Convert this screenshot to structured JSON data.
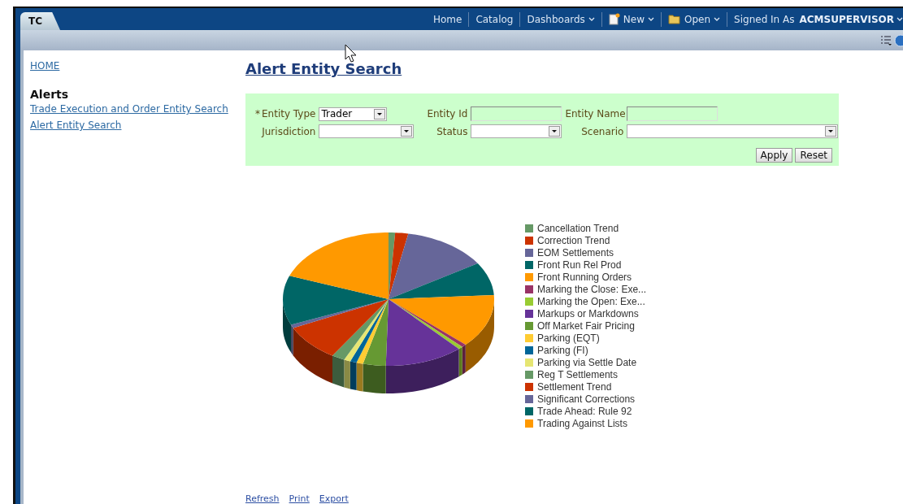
{
  "tab": {
    "label": "TC",
    "selected": true
  },
  "nav": [
    {
      "label": "Home",
      "kind": "plain"
    },
    {
      "label": "Catalog",
      "kind": "plain"
    },
    {
      "label": "Dashboards",
      "kind": "dropdown"
    },
    {
      "label": "New",
      "kind": "create"
    },
    {
      "label": "Open",
      "kind": "folder"
    }
  ],
  "signed_in": {
    "label": "Signed In As",
    "user": "ACMSUPERVISOR"
  },
  "sidebar": {
    "home": "HOME",
    "heading": "Alerts",
    "links": [
      "Trade Execution and Order Entity Search",
      "Alert Entity Search"
    ]
  },
  "page_title": "Alert Entity Search",
  "form": {
    "rows": [
      [
        {
          "label": "Entity Type",
          "required": true,
          "kind": "select",
          "value": "Trader"
        },
        {
          "label": "Entity Id",
          "required": false,
          "kind": "text"
        },
        {
          "label": "Entity Name",
          "required": false,
          "kind": "text"
        }
      ],
      [
        {
          "label": "Jurisdiction",
          "required": false,
          "kind": "select"
        },
        {
          "label": "Status",
          "required": false,
          "kind": "select"
        },
        {
          "label": "Scenario",
          "required": false,
          "kind": "select"
        }
      ]
    ],
    "required_mark": "*",
    "buttons": [
      "Apply",
      "Reset"
    ]
  },
  "legend": [
    {
      "label": "Cancellation Trend",
      "color": "#669966"
    },
    {
      "label": "Correction Trend",
      "color": "#cc3300"
    },
    {
      "label": "EOM Settlements",
      "color": "#666699"
    },
    {
      "label": "Front Run Rel Prod",
      "color": "#006666"
    },
    {
      "label": "Front Running Orders",
      "color": "#ff9900"
    },
    {
      "label": "Marking the Close: Exe...",
      "color": "#993366"
    },
    {
      "label": "Marking the Open: Exe...",
      "color": "#99cc33"
    },
    {
      "label": "Markups or Markdowns",
      "color": "#663399"
    },
    {
      "label": "Off Market Fair Pricing",
      "color": "#669933"
    },
    {
      "label": "Parking (EQT)",
      "color": "#ffcc33"
    },
    {
      "label": "Parking (FI)",
      "color": "#006699"
    },
    {
      "label": "Parking via Settle Date",
      "color": "#e6e673"
    },
    {
      "label": "Reg T Settlements",
      "color": "#669966"
    },
    {
      "label": "Settlement Trend",
      "color": "#cc3300"
    },
    {
      "label": "Significant Corrections",
      "color": "#666699"
    },
    {
      "label": "Trade Ahead: Rule 92",
      "color": "#006666"
    },
    {
      "label": "Trading Against Lists",
      "color": "#ff9900"
    }
  ],
  "footer_links": [
    "Refresh",
    "Print",
    "Export"
  ]
}
